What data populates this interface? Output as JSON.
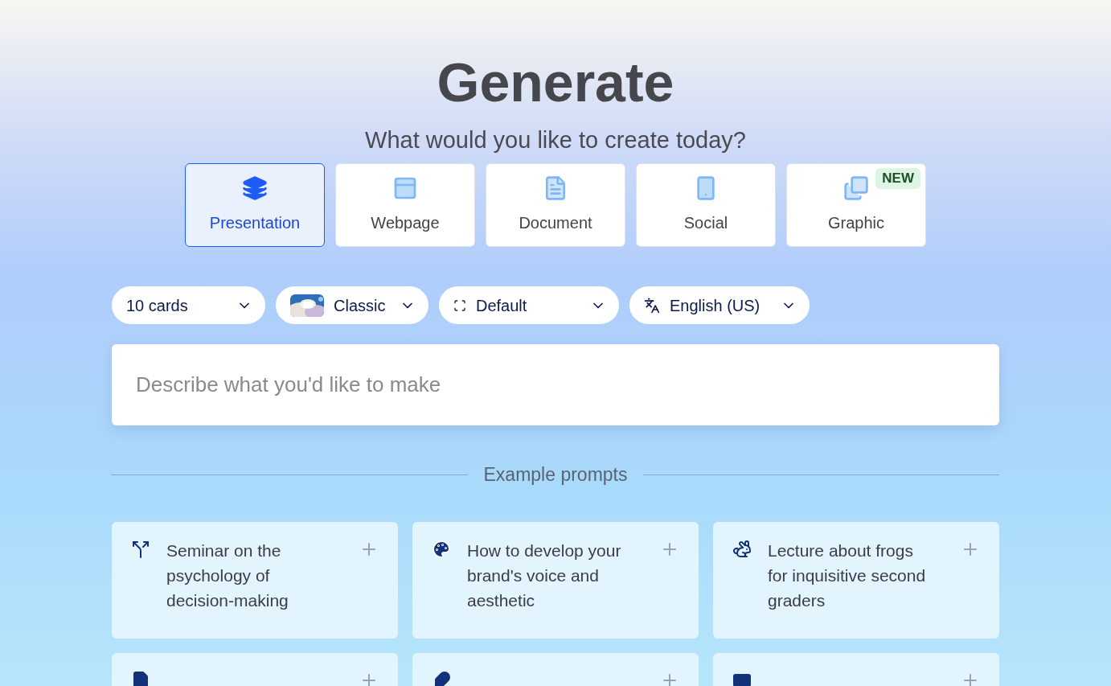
{
  "title": "Generate",
  "subtitle": "What would you like to create today?",
  "types": [
    {
      "kind": "presentation",
      "label": "Presentation",
      "selected": true
    },
    {
      "kind": "webpage",
      "label": "Webpage",
      "selected": false
    },
    {
      "kind": "document",
      "label": "Document",
      "selected": false
    },
    {
      "kind": "social",
      "label": "Social",
      "selected": false
    },
    {
      "kind": "graphic",
      "label": "Graphic",
      "selected": false,
      "badge": "NEW"
    }
  ],
  "options": [
    {
      "kind": "count",
      "label": "10 cards"
    },
    {
      "kind": "theme",
      "label": "Classic"
    },
    {
      "kind": "format",
      "label": "Default"
    },
    {
      "kind": "language",
      "label": "English (US)"
    }
  ],
  "prompt": {
    "placeholder": "Describe what you'd like to make"
  },
  "examples_heading": "Example prompts",
  "examples": [
    {
      "kind": "branch",
      "text": "Seminar on the psychology of decision-making"
    },
    {
      "kind": "palette",
      "text": "How to develop your brand's voice and aesthetic"
    },
    {
      "kind": "animal",
      "text": "Lecture about frogs for inquisitive second graders"
    },
    {
      "kind": "file"
    },
    {
      "kind": "feather"
    },
    {
      "kind": "card"
    }
  ]
}
